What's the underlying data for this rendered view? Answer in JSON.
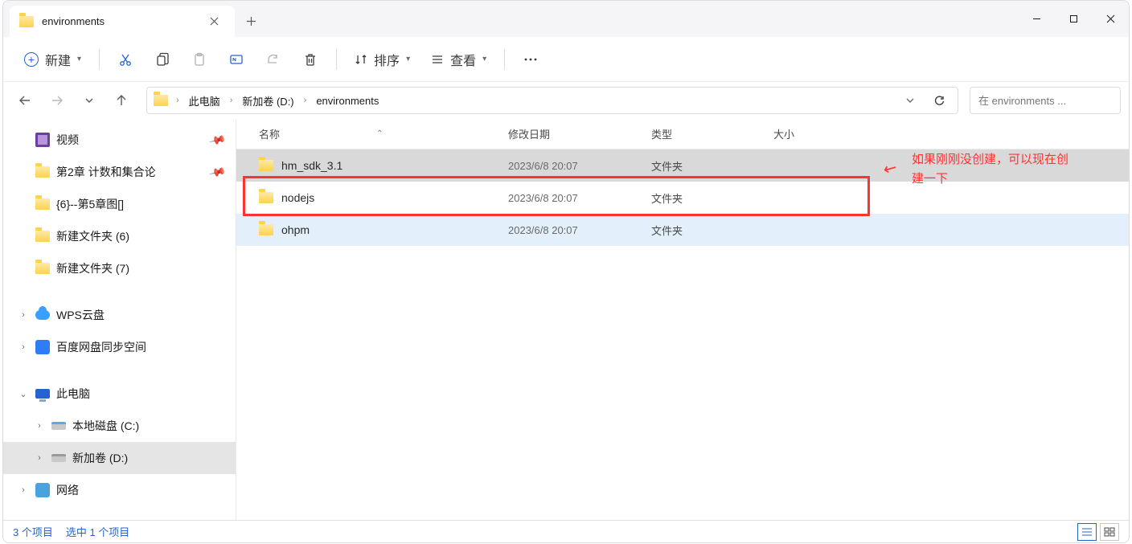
{
  "tab": {
    "title": "environments"
  },
  "toolbar": {
    "new_label": "新建",
    "sort_label": "排序",
    "view_label": "查看"
  },
  "breadcrumb": {
    "items": [
      "此电脑",
      "新加卷 (D:)",
      "environments"
    ]
  },
  "search": {
    "placeholder": "在 environments ..."
  },
  "sidebar": {
    "quick": [
      {
        "label": "视频",
        "icon": "video",
        "pinned": true
      },
      {
        "label": "第2章 计数和集合论",
        "icon": "folder",
        "pinned": true
      },
      {
        "label": "{6}--第5章图[]",
        "icon": "folder"
      },
      {
        "label": "新建文件夹 (6)",
        "icon": "folder"
      },
      {
        "label": "新建文件夹 (7)",
        "icon": "folder"
      }
    ],
    "drives": [
      {
        "label": "WPS云盘",
        "icon": "cloud",
        "expandable": true
      },
      {
        "label": "百度网盘同步空间",
        "icon": "baidu",
        "expandable": true
      }
    ],
    "pc": {
      "label": "此电脑",
      "expanded": true
    },
    "volumes": [
      {
        "label": "本地磁盘 (C:)",
        "icon": "disk"
      },
      {
        "label": "新加卷 (D:)",
        "icon": "disk",
        "selected": true
      }
    ],
    "network": {
      "label": "网络"
    }
  },
  "columns": {
    "name": "名称",
    "date": "修改日期",
    "type": "类型",
    "size": "大小"
  },
  "files": [
    {
      "name": "hm_sdk_3.1",
      "date": "2023/6/8 20:07",
      "type": "文件夹",
      "state": "selected"
    },
    {
      "name": "nodejs",
      "date": "2023/6/8 20:07",
      "type": "文件夹",
      "state": ""
    },
    {
      "name": "ohpm",
      "date": "2023/6/8 20:07",
      "type": "文件夹",
      "state": "hover"
    }
  ],
  "annotation": {
    "line1": "如果刚刚没创建，可以现在创",
    "line2": "建一下"
  },
  "status": {
    "count": "3 个项目",
    "selected": "选中 1 个项目"
  }
}
